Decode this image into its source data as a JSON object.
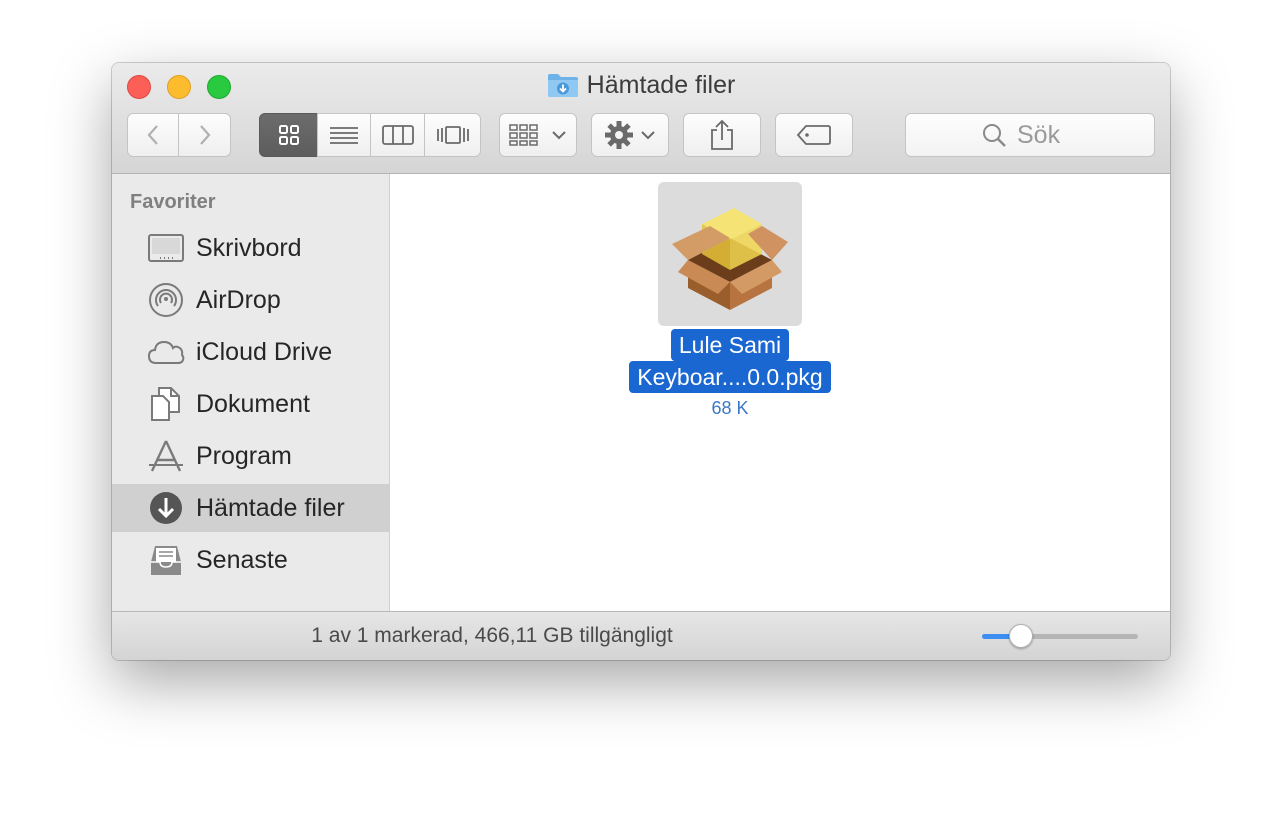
{
  "window": {
    "title": "Hämtade filer"
  },
  "toolbar": {
    "back_icon": "chevron-left-icon",
    "forward_icon": "chevron-right-icon",
    "view_modes": [
      "icon-view",
      "list-view",
      "column-view",
      "cover-flow-view"
    ],
    "active_view": "icon-view",
    "arrange_icon": "arrange-grid-icon",
    "action_icon": "gear-icon",
    "share_icon": "share-icon",
    "tag_icon": "tag-icon"
  },
  "search": {
    "placeholder": "Sök"
  },
  "sidebar": {
    "header": "Favoriter",
    "items": [
      {
        "label": "Skrivbord",
        "icon": "desktop-icon",
        "selected": false
      },
      {
        "label": "AirDrop",
        "icon": "airdrop-icon",
        "selected": false
      },
      {
        "label": "iCloud Drive",
        "icon": "cloud-icon",
        "selected": false
      },
      {
        "label": "Dokument",
        "icon": "documents-icon",
        "selected": false
      },
      {
        "label": "Program",
        "icon": "applications-icon",
        "selected": false
      },
      {
        "label": "Hämtade filer",
        "icon": "downloads-icon",
        "selected": true
      },
      {
        "label": "Senaste",
        "icon": "recents-icon",
        "selected": false
      }
    ]
  },
  "files": [
    {
      "name_line1": "Lule Sami",
      "name_line2": "Keyboar....0.0.pkg",
      "size": "68 K",
      "icon": "package-icon",
      "selected": true
    }
  ],
  "statusbar": {
    "text": "1 av 1 markerad, 466,11 GB tillgängligt",
    "icon_size_fraction": 0.25
  },
  "colors": {
    "selection": "#1a67d2",
    "close": "#fc5f57",
    "minimize": "#fdbc2e",
    "maximize": "#29c940",
    "slider_accent": "#3d8ef2"
  }
}
